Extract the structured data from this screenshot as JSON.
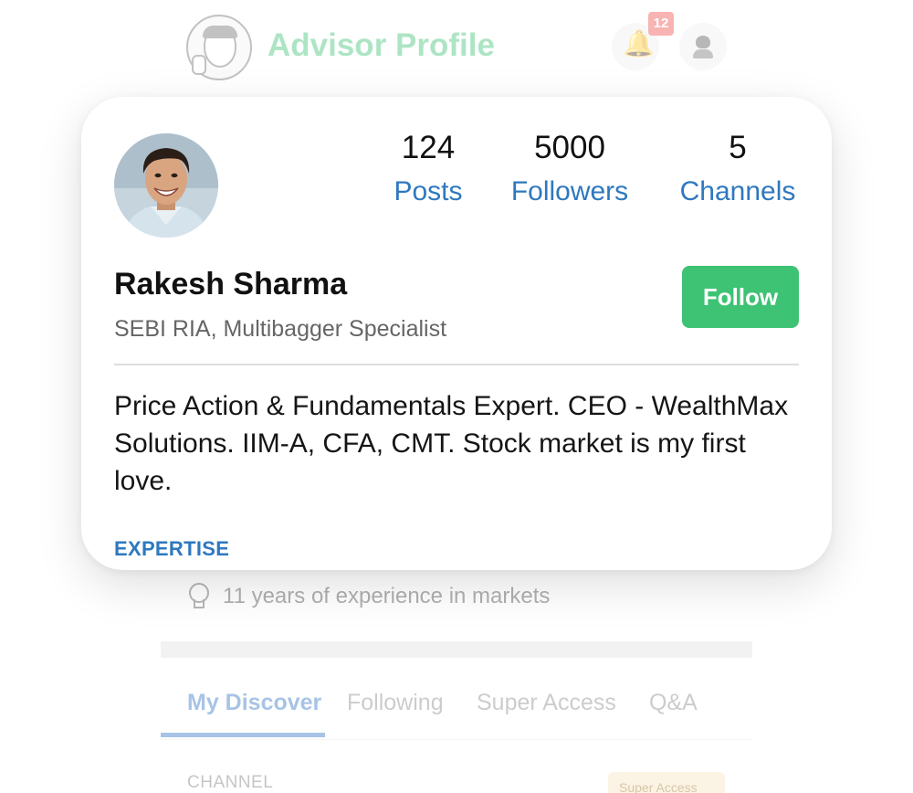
{
  "header": {
    "title": "Advisor Profile",
    "notification_count": "12",
    "logo_icon": "cartoon-advisor-logo",
    "bell_icon": "bell-icon",
    "profile_icon": "user-avatar-icon"
  },
  "profile": {
    "stats": [
      {
        "value": "124",
        "label": "Posts"
      },
      {
        "value": "5000",
        "label": "Followers"
      },
      {
        "value": "5",
        "label": "Channels"
      }
    ],
    "name": "Rakesh Sharma",
    "subtitle": "SEBI RIA, Multibagger Specialist",
    "follow_label": "Follow",
    "bio": "Price Action & Fundamentals Expert. CEO - WealthMax Solutions. IIM-A, CFA, CMT. Stock market is my first love.",
    "expertise_heading": "EXPERTISE"
  },
  "background": {
    "experience": "11 years of experience in markets",
    "tabs": [
      "My Discover",
      "Following",
      "Super Access",
      "Q&A"
    ],
    "active_tab": "My Discover",
    "section_label": "CHANNEL",
    "badge_label": "Super Access"
  },
  "colors": {
    "accent_blue": "#2e78bf",
    "follow_green": "#3ec274",
    "badge_red": "#ef4d4d"
  }
}
